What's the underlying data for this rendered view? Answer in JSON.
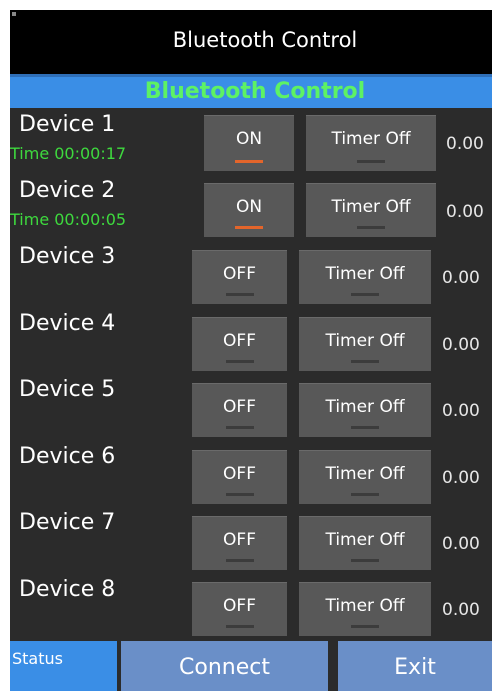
{
  "titlebar": {
    "title": "Bluetooth Control"
  },
  "header": {
    "title": "Bluetooth Control"
  },
  "devices": [
    {
      "name": "Device 1",
      "timer": "Time 00:00:17",
      "state": "ON",
      "timer_button": "Timer Off",
      "value": "0.00"
    },
    {
      "name": "Device 2",
      "timer": "Time 00:00:05",
      "state": "ON",
      "timer_button": "Timer Off",
      "value": "0.00"
    },
    {
      "name": "Device 3",
      "timer": "",
      "state": "OFF",
      "timer_button": "Timer Off",
      "value": "0.00"
    },
    {
      "name": "Device 4",
      "timer": "",
      "state": "OFF",
      "timer_button": "Timer Off",
      "value": "0.00"
    },
    {
      "name": "Device 5",
      "timer": "",
      "state": "OFF",
      "timer_button": "Timer Off",
      "value": "0.00"
    },
    {
      "name": "Device 6",
      "timer": "",
      "state": "OFF",
      "timer_button": "Timer Off",
      "value": "0.00"
    },
    {
      "name": "Device 7",
      "timer": "",
      "state": "OFF",
      "timer_button": "Timer Off",
      "value": "0.00"
    },
    {
      "name": "Device 8",
      "timer": "",
      "state": "OFF",
      "timer_button": "Timer Off",
      "value": "0.00"
    }
  ],
  "bottombar": {
    "status_label": "Status",
    "connect_label": "Connect",
    "exit_label": "Exit"
  },
  "colors": {
    "accent_blue": "#3a8ee6",
    "button_blue": "#6a8fc8",
    "header_text_green": "#5df264",
    "timer_text_green": "#3ed93e",
    "on_indicator": "#e3652b",
    "background": "#2b2b2b"
  }
}
